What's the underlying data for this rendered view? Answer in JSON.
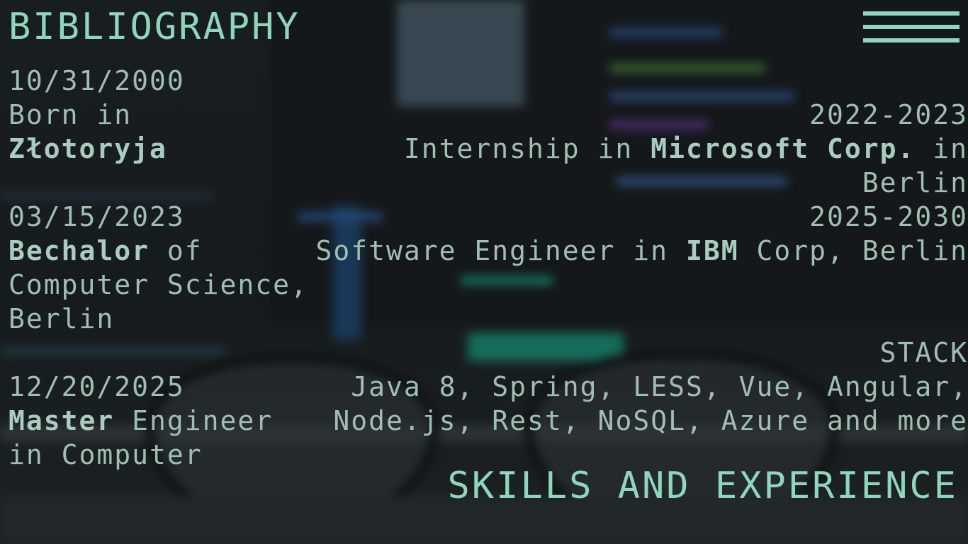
{
  "bibliography": {
    "title": "BIBLIOGRAPHY",
    "birth": {
      "date": "10/31/2000",
      "prefix": "Born in",
      "city": "Złotoryja"
    },
    "bachelor": {
      "date": "03/15/2023",
      "degree": "Bechalor",
      "of": " of",
      "field": "Computer Science,",
      "city": "Berlin"
    },
    "master": {
      "date": "12/20/2025",
      "degree": "Master",
      "rest": " Engineer",
      "field": "in Computer"
    }
  },
  "experience": {
    "items": [
      {
        "years": "2022-2023",
        "prefix": "Internship in ",
        "company": "Microsoft Corp.",
        "suffix": " in",
        "city": "Berlin"
      },
      {
        "years": "2025-2030",
        "prefix": "Software Engineer in ",
        "company": "IBM",
        "suffix": " Corp, Berlin"
      }
    ]
  },
  "stack": {
    "title": "STACK",
    "line1": "Java 8, Spring, LESS, Vue, Angular,",
    "line2": "Node.js, Rest, NoSQL, Azure and more"
  },
  "skills_title": "SKILLS AND EXPERIENCE",
  "menu": {
    "icon": "hamburger-menu-icon"
  },
  "colors": {
    "accent": "#8fd6bc",
    "text": "#9fbfb2",
    "background": "#1b1f21"
  }
}
